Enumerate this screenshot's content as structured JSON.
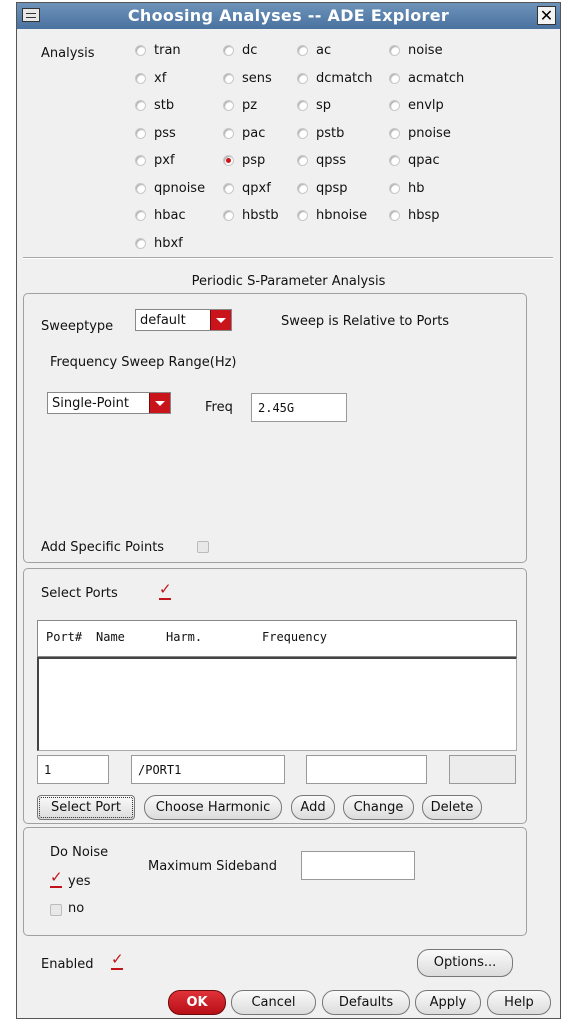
{
  "window": {
    "title": "Choosing Analyses -- ADE Explorer",
    "close_glyph": "✕"
  },
  "analysis": {
    "label": "Analysis",
    "options": [
      "tran",
      "dc",
      "ac",
      "noise",
      "xf",
      "sens",
      "dcmatch",
      "acmatch",
      "stb",
      "pz",
      "sp",
      "envlp",
      "pss",
      "pac",
      "pstb",
      "pnoise",
      "pxf",
      "psp",
      "qpss",
      "qpac",
      "qpnoise",
      "qpxf",
      "qpsp",
      "hb",
      "hbac",
      "hbstb",
      "hbnoise",
      "hbsp",
      "hbxf"
    ],
    "selected": "psp"
  },
  "section_title": "Periodic S-Parameter Analysis",
  "sweep": {
    "sweeptype_label": "Sweeptype",
    "sweeptype_value": "default",
    "relative_note": "Sweep is Relative to Ports",
    "range_label": "Frequency Sweep Range(Hz)",
    "range_value": "Single-Point",
    "freq_label": "Freq",
    "freq_value": "2.45G",
    "specific_points_label": "Add Specific Points",
    "specific_points_checked": false
  },
  "ports": {
    "select_label": "Select Ports",
    "select_checked": true,
    "col_port": "Port#",
    "col_name": "Name",
    "col_harm": "Harm.",
    "col_freq": "Frequency",
    "port_num": "1",
    "port_name": "/PORT1",
    "harm": "",
    "freq": "",
    "buttons": {
      "select_port": "Select Port",
      "choose_harmonic": "Choose Harmonic",
      "add": "Add",
      "change": "Change",
      "delete": "Delete"
    }
  },
  "noise": {
    "label": "Do Noise",
    "yes_label": "yes",
    "yes_checked": true,
    "no_label": "no",
    "no_checked": false,
    "max_sideband_label": "Maximum Sideband",
    "max_sideband_value": ""
  },
  "enabled": {
    "label": "Enabled",
    "checked": true
  },
  "buttons": {
    "options": "Options...",
    "ok": "OK",
    "cancel": "Cancel",
    "defaults": "Defaults",
    "apply": "Apply",
    "help": "Help"
  },
  "colors": {
    "accent_red": "#c8141a",
    "title_blue": "#4a72a0",
    "panel": "#f0f0f0"
  }
}
